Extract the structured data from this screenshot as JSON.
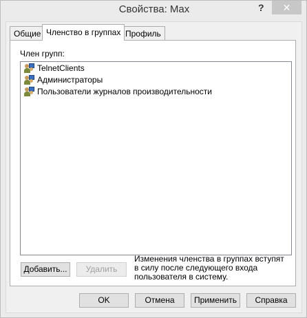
{
  "window": {
    "title": "Свойства: Max",
    "help": "?",
    "close": "✕"
  },
  "tabs": [
    {
      "label": "Общие"
    },
    {
      "label": "Членство в группах"
    },
    {
      "label": "Профиль"
    }
  ],
  "members_label": "Член групп:",
  "groups": [
    {
      "name": "TelnetClients",
      "icon": "group-icon"
    },
    {
      "name": "Администраторы",
      "icon": "group-icon"
    },
    {
      "name": "Пользователи журналов производительности",
      "icon": "group-icon"
    }
  ],
  "add_button": "Добавить...",
  "remove_button": "Удалить",
  "note": "Изменения членства в группах вступят в силу после следующего входа пользователя в систему.",
  "buttons": {
    "ok": "OK",
    "cancel": "Отмена",
    "apply": "Применить",
    "help": "Справка"
  }
}
